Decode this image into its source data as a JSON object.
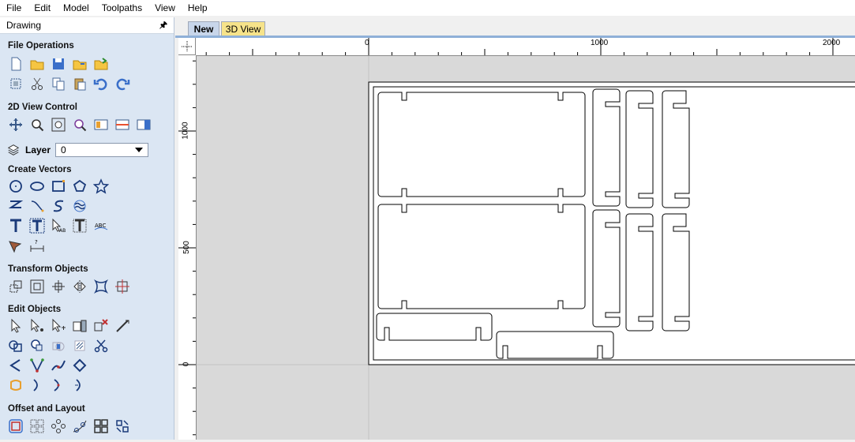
{
  "menu": [
    "File",
    "Edit",
    "Model",
    "Toolpaths",
    "View",
    "Help"
  ],
  "panel": {
    "title": "Drawing",
    "sections": {
      "file_operations": "File Operations",
      "view_control": "2D View Control",
      "create_vectors": "Create Vectors",
      "transform_objects": "Transform Objects",
      "edit_objects": "Edit Objects",
      "offset_layout": "Offset and Layout"
    },
    "layer": {
      "label": "Layer",
      "value": "0"
    }
  },
  "tabs": {
    "new": "New",
    "view3d": "3D View"
  },
  "ruler": {
    "h_labels": [
      "0",
      "1000",
      "2000"
    ],
    "v_labels": [
      "1000",
      "500",
      "0"
    ]
  },
  "colors": {
    "panel_bg": "#dbe6f3",
    "canvas_bg": "#d9d9d9",
    "sheet": "#ffffff",
    "tab_new": "#c8d6ea",
    "tab_3d": "#f6e38a",
    "accent_blue": "#2a6fc9"
  }
}
